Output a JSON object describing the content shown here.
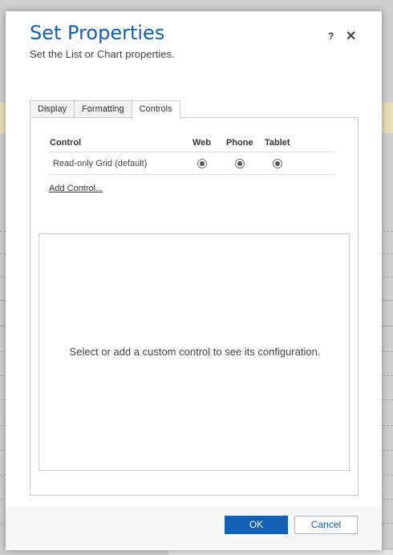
{
  "dialog": {
    "title": "Set Properties",
    "subtitle": "Set the List or Chart properties.",
    "help_icon": "?",
    "close_icon": "✕"
  },
  "tabs": [
    {
      "label": "Display"
    },
    {
      "label": "Formatting"
    },
    {
      "label": "Controls",
      "active": true
    }
  ],
  "controls_grid": {
    "headers": [
      "Control",
      "Web",
      "Phone",
      "Tablet"
    ],
    "rows": [
      {
        "control": "Read-only Grid (default)",
        "web": true,
        "phone": true,
        "tablet": true
      }
    ]
  },
  "add_control_link": "Add Control...",
  "config_message": "Select or add a custom control to see its configuration.",
  "footer": {
    "ok_label": "OK",
    "cancel_label": "Cancel"
  },
  "colors": {
    "accent": "#1160b7",
    "banner": "#e6dfb7"
  }
}
